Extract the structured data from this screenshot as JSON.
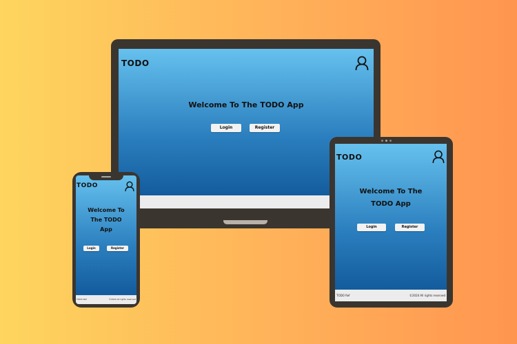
{
  "app": {
    "brand": "TODO",
    "welcome": "Welcome To The TODO App",
    "welcome_phone_l1": "Welcome To",
    "welcome_phone_l2": "The TODO",
    "welcome_phone_l3": "App",
    "welcome_tablet_l1": "Welcome To The",
    "welcome_tablet_l2": "TODO App",
    "login_label": "Login",
    "register_label": "Register",
    "footer_left": "TODO Ref",
    "footer_right": "©2024 All rights reserved",
    "user_icon": "user-icon"
  },
  "colors": {
    "background_left": "#fed55e",
    "background_right": "#ff9550",
    "bezel": "#3b3530",
    "screen_top": "#66c1ee",
    "screen_bottom": "#0e5496",
    "button": "#f2f2f2"
  }
}
